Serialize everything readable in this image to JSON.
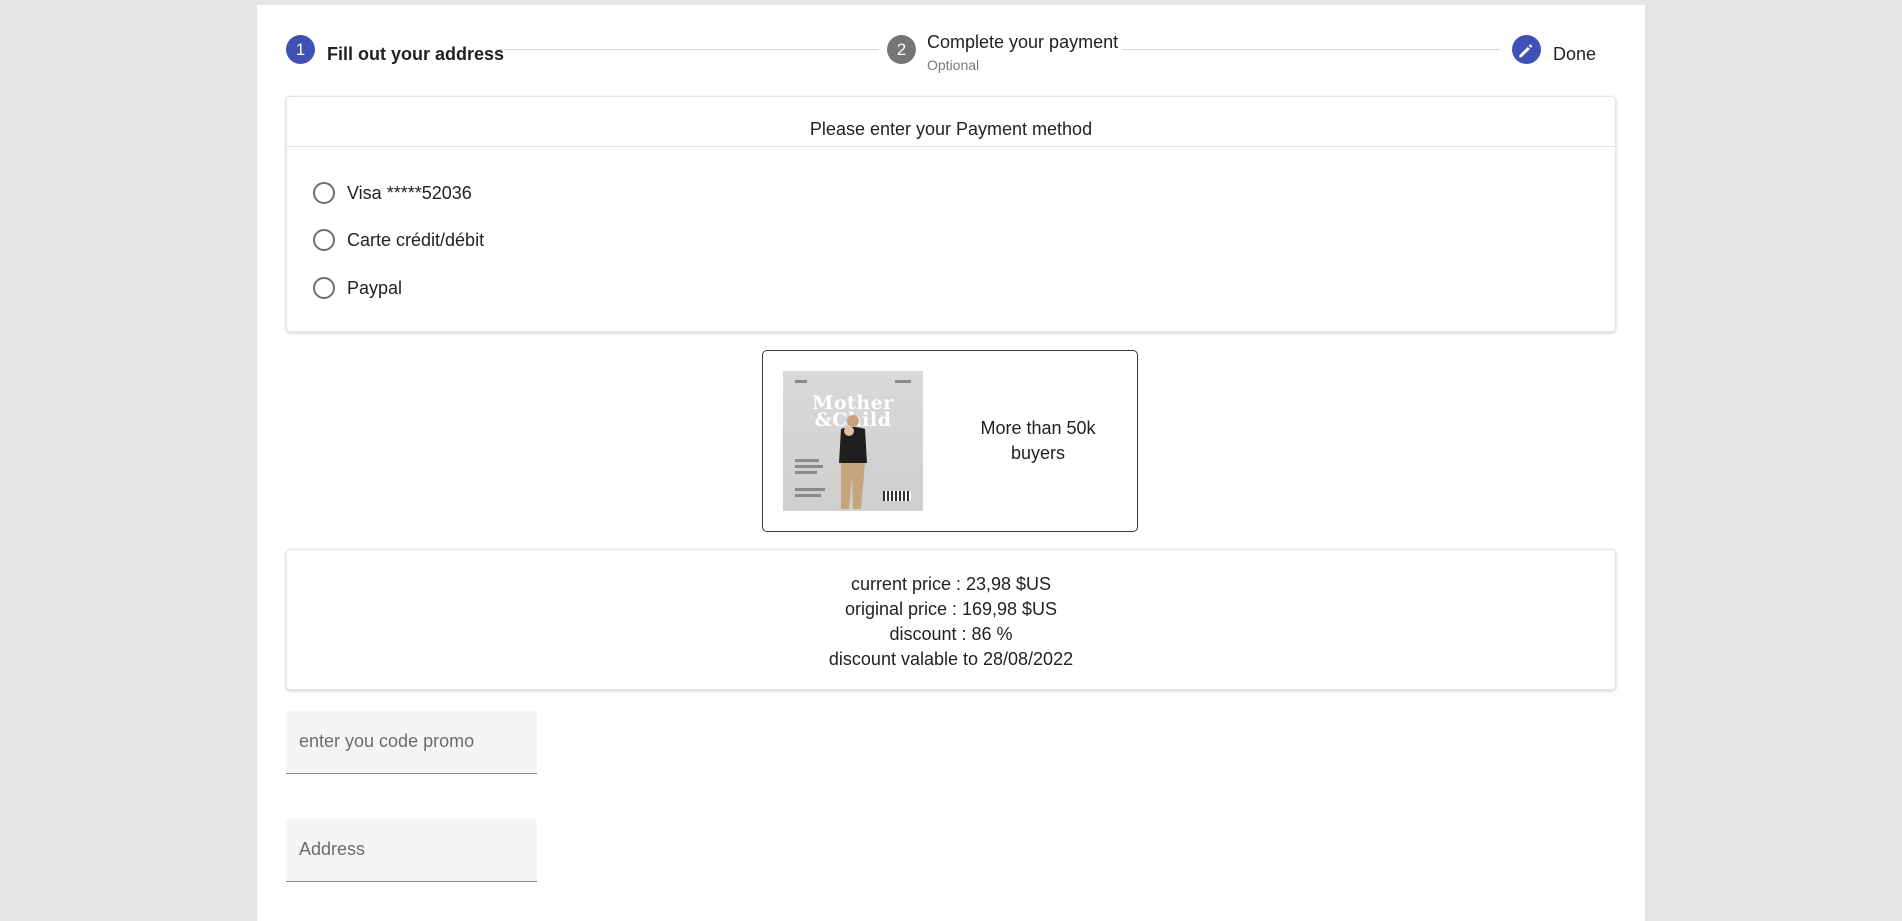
{
  "stepper": {
    "steps": [
      {
        "number": "1",
        "label": "Fill out your address",
        "state": "active"
      },
      {
        "number": "2",
        "label": "Complete your payment",
        "sublabel": "Optional",
        "state": "inactive"
      },
      {
        "number": "",
        "label": "Done",
        "state": "edit",
        "icon": "pencil-icon"
      }
    ]
  },
  "payment": {
    "title": "Please enter your Payment method",
    "options": [
      {
        "label": "Visa *****52036",
        "selected": false
      },
      {
        "label": "Carte crédit/débit",
        "selected": false
      },
      {
        "label": "Paypal",
        "selected": false
      }
    ]
  },
  "product": {
    "cover_title_line1": "Mother",
    "cover_title_line2": "&Child",
    "buyers_text": "More than 50k buyers"
  },
  "price": {
    "current": "current price : 23,98 $US",
    "original": "original price : 169,98 $US",
    "discount": "discount : 86 %",
    "valid_until": "discount valable to 28/08/2022"
  },
  "form": {
    "promo_placeholder": "enter you code promo",
    "promo_value": "",
    "address_placeholder": "Address",
    "address_value": ""
  },
  "colors": {
    "accent": "#3f51b5",
    "inactive_step": "#757575",
    "page_background": "#e4e5e7"
  }
}
